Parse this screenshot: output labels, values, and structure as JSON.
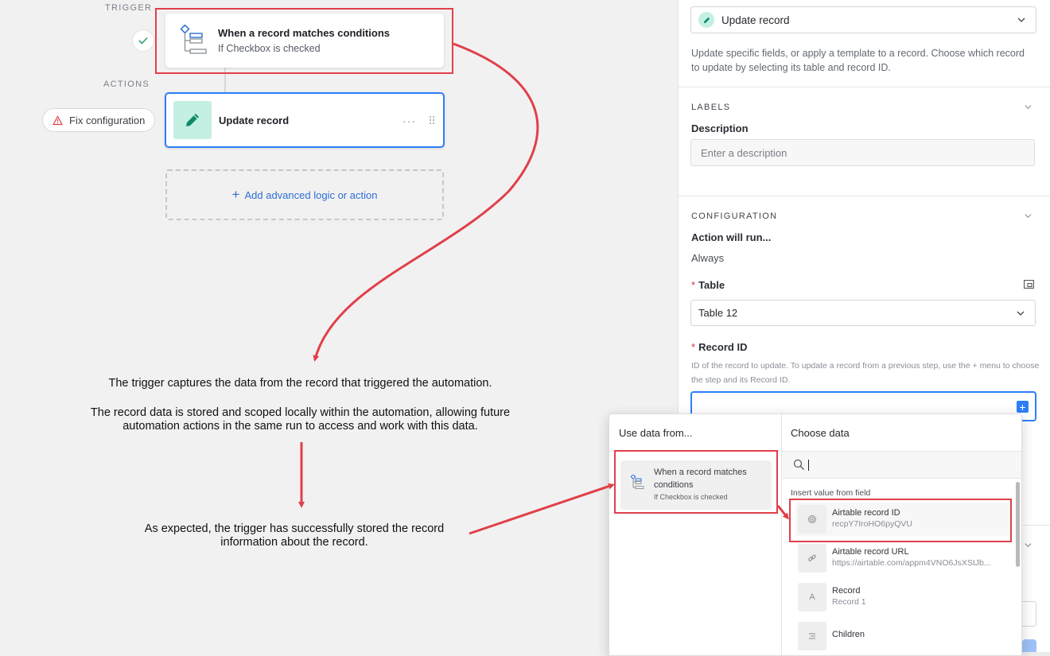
{
  "canvas": {
    "trigger_label": "TRIGGER",
    "actions_label": "ACTIONS",
    "trigger_node": {
      "title": "When a record matches conditions",
      "subtitle": "If Checkbox is checked"
    },
    "action_node": {
      "title": "Update record",
      "more": "···"
    },
    "fix_config": "Fix configuration",
    "add_logic": "Add advanced logic or action"
  },
  "annotations": {
    "a1": "The trigger captures the data from the record that triggered the automation.",
    "a2": "The record data is stored and scoped locally within the automation, allowing future automation actions in the same run to access and work with this data.",
    "a3": "As expected, the trigger has successfully stored the record information about the record."
  },
  "panel": {
    "action_type": "Update record",
    "description": "Update specific fields, or apply a template to a record. Choose which record to update by selecting its table and record ID.",
    "labels_section": "LABELS",
    "description_label": "Description",
    "description_placeholder": "Enter a description",
    "config_section": "CONFIGURATION",
    "action_will_run": "Action will run...",
    "action_will_run_value": "Always",
    "table_label": "Table",
    "table_value": "Table 12",
    "record_id_label": "Record ID",
    "record_id_help": "ID of the record to update. To update a record from a previous step, use the + menu to choose the step and its Record ID."
  },
  "popover": {
    "left_header": "Use data from...",
    "right_header": "Choose data",
    "source": {
      "title": "When a record matches conditions",
      "subtitle": "If Checkbox is checked"
    },
    "insert_label": "Insert value from field",
    "fields": [
      {
        "title": "Airtable record ID",
        "value": "recpY7IroHO6pyQVU",
        "icon": "fingerprint-icon"
      },
      {
        "title": "Airtable record URL",
        "value": "https://airtable.com/appm4VNO6JsXStJb...",
        "icon": "link-icon"
      },
      {
        "title": "Record",
        "value": "Record 1",
        "icon": "text-a-icon"
      },
      {
        "title": "Children",
        "value": "",
        "icon": "list-icon"
      }
    ]
  },
  "colors": {
    "accent": "#2d7ff9",
    "annotation_red": "#e0404a",
    "mint": "#c3f0e2"
  }
}
